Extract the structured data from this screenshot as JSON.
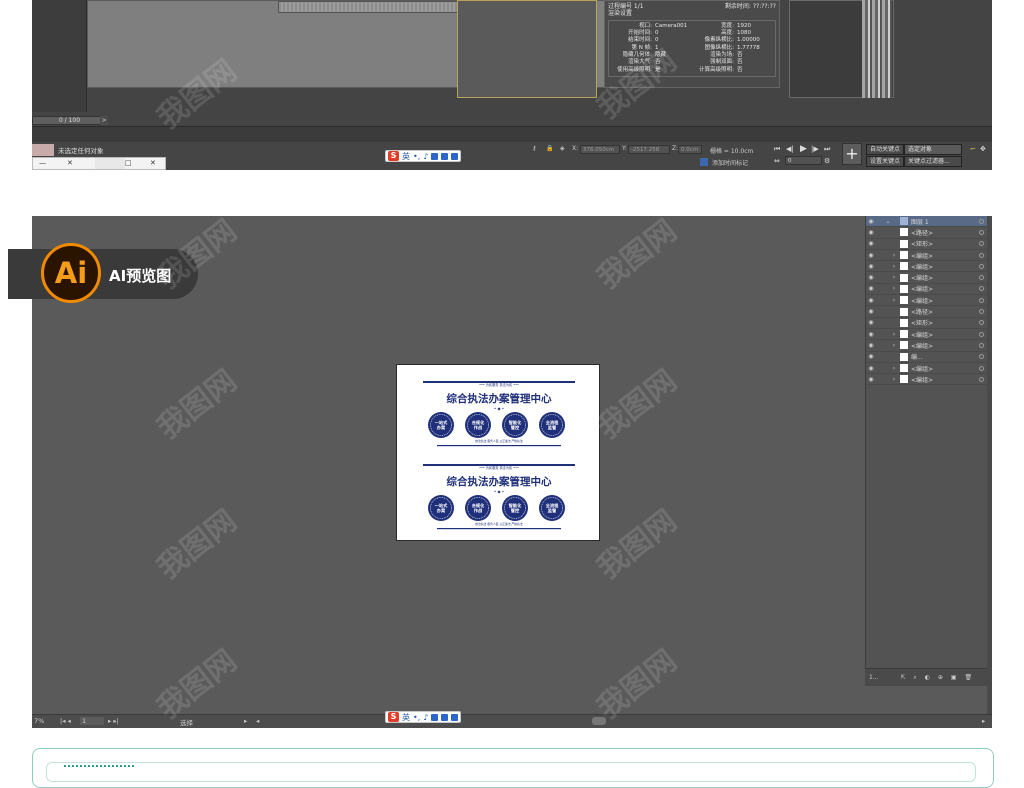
{
  "max_app": {
    "render_info": {
      "frame_no": "过程编号 1/1",
      "remaining": "剩余时间: ??:??:??",
      "section": "渲染设置",
      "left_keys": [
        "视口",
        "开始时间",
        "结束时间",
        "第 N 帧",
        "隐藏几何体",
        "渲染大气",
        "使用高级照明"
      ],
      "left_vals": [
        "Camera001",
        "0",
        "0",
        "1",
        "隐藏",
        "否",
        "是"
      ],
      "right_keys": [
        "宽度",
        "高度",
        "像素纵横比",
        "图像纵横比",
        "渲染为场",
        "强制双面",
        "计算高级照明"
      ],
      "right_vals": [
        "1920",
        "1080",
        "1.00000",
        "1.77778",
        "否",
        "否",
        "否"
      ]
    },
    "frame_counter": "0 / 100",
    "status_text": "未选定任何对象",
    "coord_x_label": "X:",
    "coord_x_value": "376.050cm",
    "coord_y_label": "Y:",
    "coord_y_value": "-2517.258",
    "coord_z_label": "Z:",
    "coord_z_value": "0.0cm",
    "grid_text": "栅格 = 10.0cm",
    "add_time_tag": "添加时间标记",
    "auto_key": "自动关键点",
    "set_key": "设置关键点",
    "selected_objects": "选定对象",
    "key_filter": "关键点过滤器...",
    "frame_field": "0",
    "playback_symbols": [
      "⏮",
      "◀||",
      "▶",
      "||▶",
      "⏭"
    ]
  },
  "ime_bar": {
    "logo": "S",
    "lang": "英",
    "symbols": [
      "•,",
      "🎤",
      "▤",
      "👕",
      "▦"
    ]
  },
  "ai_badge": {
    "logo": "Ai",
    "label": "AI预览图"
  },
  "artboard": {
    "tagline_top": "••• 为民服务  执法为民 •••",
    "title": "综合执法办案管理中心",
    "badges": [
      "一站式\n办案",
      "合规化\n作战",
      "智能化\n管控",
      "全流程\n监管"
    ],
    "badges2": [
      "一站式\n办案",
      "合规化\n作战",
      "智能化\n管控",
      "全流程\n监管"
    ],
    "footer": "依法执法  服务人民  公正廉洁  严格执法"
  },
  "layers": {
    "header": "图层 1",
    "rows": [
      "<路径>",
      "<矩形>",
      "<编组>",
      "<编组>",
      "<编组>",
      "<编组>",
      "<编组>",
      "<路径>",
      "<矩形>",
      "<编组>",
      "<编组>",
      "编...",
      "<编组>",
      "<编组>"
    ],
    "footer": "1..."
  },
  "ai_status": {
    "zoom": "7%",
    "page": "1",
    "tool": "选择"
  },
  "watermark": "我图网",
  "colors": {
    "navy": "#1f2f7a",
    "ai_orange": "#f08a00",
    "teal": "#2d9f86"
  }
}
